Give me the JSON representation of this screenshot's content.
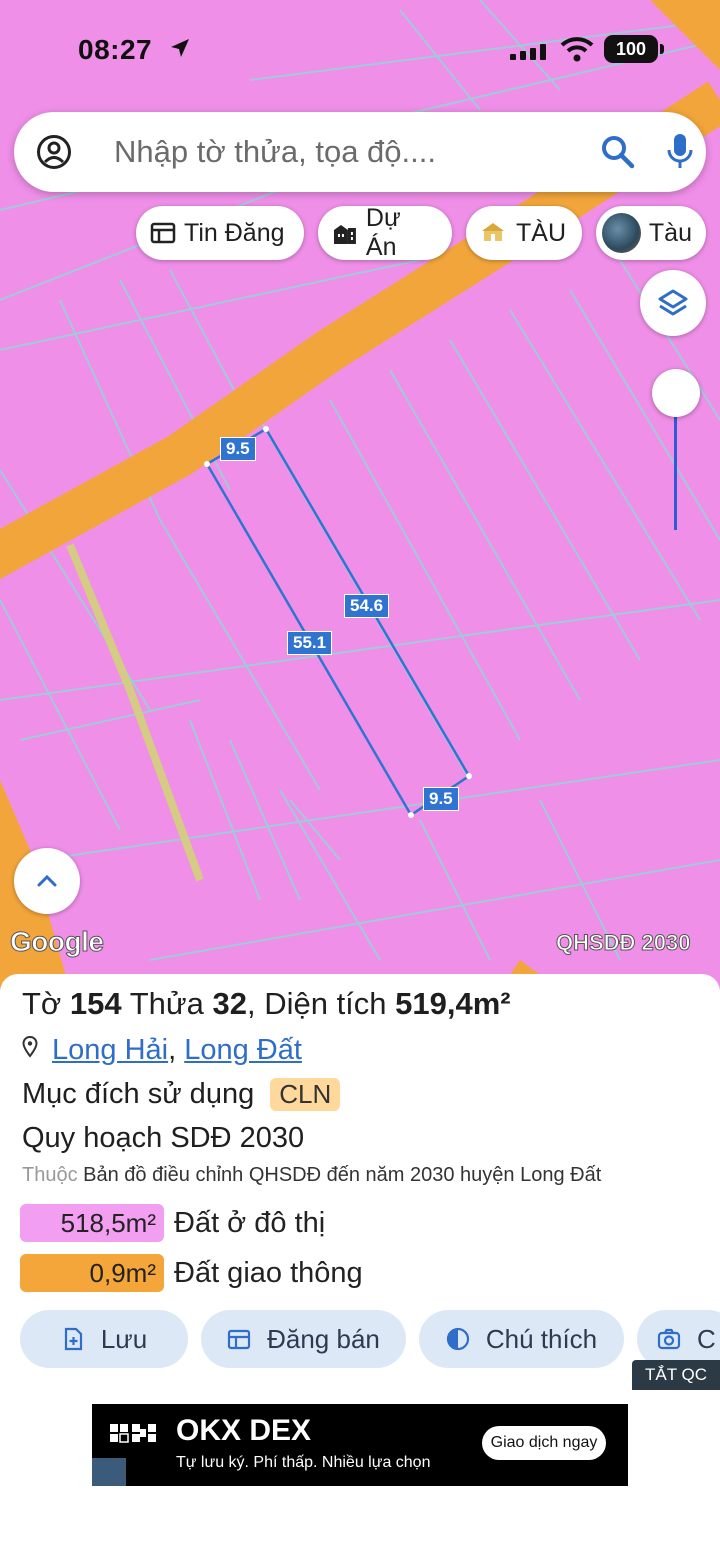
{
  "status_bar": {
    "time": "08:27",
    "battery": "100"
  },
  "search": {
    "placeholder": "Nhập tờ thửa, tọa độ...."
  },
  "chips": [
    {
      "label": "Tin Đăng",
      "icon": "newspaper-icon"
    },
    {
      "label": "Dự Án",
      "icon": "buildings-icon"
    },
    {
      "label": "TÀU",
      "icon": "house-thumbnail-icon"
    },
    {
      "label": "Tàu",
      "icon": "avatar-thumbnail"
    }
  ],
  "map": {
    "measurements": [
      "9.5",
      "54.6",
      "55.1",
      "9.5"
    ],
    "watermark_left": "Google",
    "watermark_right": "QHSDĐ 2030",
    "colors": {
      "land": "#ef8fe8",
      "road": "#f2a53a",
      "parcel_outline": "#2f74d0"
    }
  },
  "parcel": {
    "title_prefix": "Tờ",
    "sheet_no": "154",
    "plot_label": "Thửa",
    "plot_no": "32",
    "area_label": "Diện tích",
    "area_value": "519,4m²",
    "location_1": "Long Hải",
    "location_sep": ",",
    "location_2": "Long Đất",
    "purpose_label": "Mục đích sử dụng",
    "purpose_code": "CLN",
    "plan_label": "Quy hoạch SDĐ 2030",
    "belongs_prefix": "Thuộc",
    "belongs_text": "Bản đồ điều chỉnh QHSDĐ đến năm 2030 huyện Long Đất",
    "zones": [
      {
        "area": "518,5m²",
        "label": "Đất ở đô thị",
        "color": "#f29ef1"
      },
      {
        "area": "0,9m²",
        "label": "Đất giao thông",
        "color": "#f5a63a"
      }
    ]
  },
  "actions": [
    {
      "label": "Lưu",
      "icon": "save-plus-icon"
    },
    {
      "label": "Đăng bán",
      "icon": "listing-icon"
    },
    {
      "label": "Chú thích",
      "icon": "contrast-icon"
    },
    {
      "label": "C",
      "icon": "camera-icon"
    }
  ],
  "ad_toggle": "TẮT QC",
  "ad": {
    "brand": "OKX DEX",
    "tagline": "Tự lưu ký. Phí thấp. Nhiều lựa chọn",
    "cta": "Giao dịch ngay"
  }
}
